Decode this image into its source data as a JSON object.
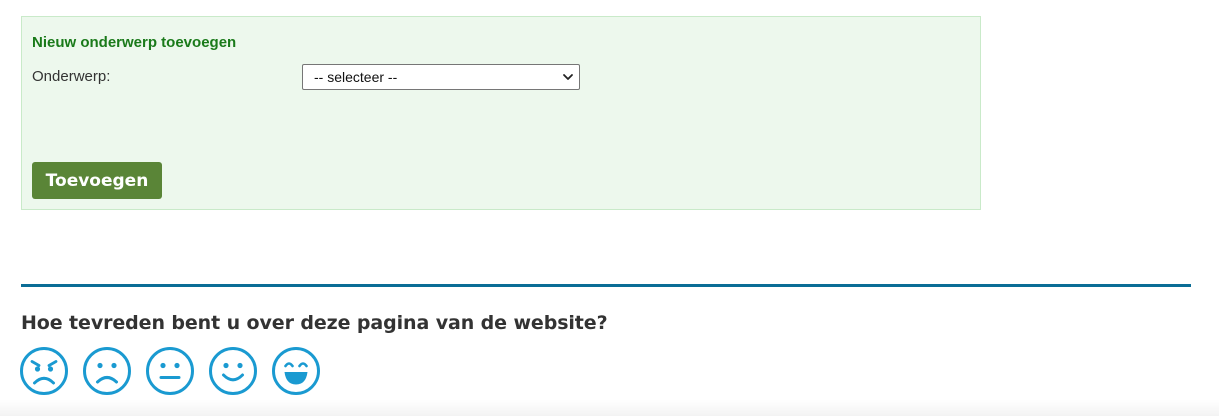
{
  "form": {
    "title": "Nieuw onderwerp toevoegen",
    "subject_label": "Onderwerp:",
    "subject_select_value": "-- selecteer --",
    "add_button_label": "Toevoegen",
    "colors": {
      "panel_background": "#edf8ed",
      "title": "#1a7a1a",
      "button": "#5a8537"
    }
  },
  "feedback": {
    "question": "Hoe tevreden bent u over deze pagina van de website?",
    "faces": [
      {
        "icon": "very-unhappy-face-icon",
        "rating": 1
      },
      {
        "icon": "unhappy-face-icon",
        "rating": 2
      },
      {
        "icon": "neutral-face-icon",
        "rating": 3
      },
      {
        "icon": "happy-face-icon",
        "rating": 4
      },
      {
        "icon": "very-happy-face-icon",
        "rating": 5
      }
    ],
    "colors": {
      "accent": "#1a9ad1",
      "divider": "#0b6d96"
    }
  }
}
